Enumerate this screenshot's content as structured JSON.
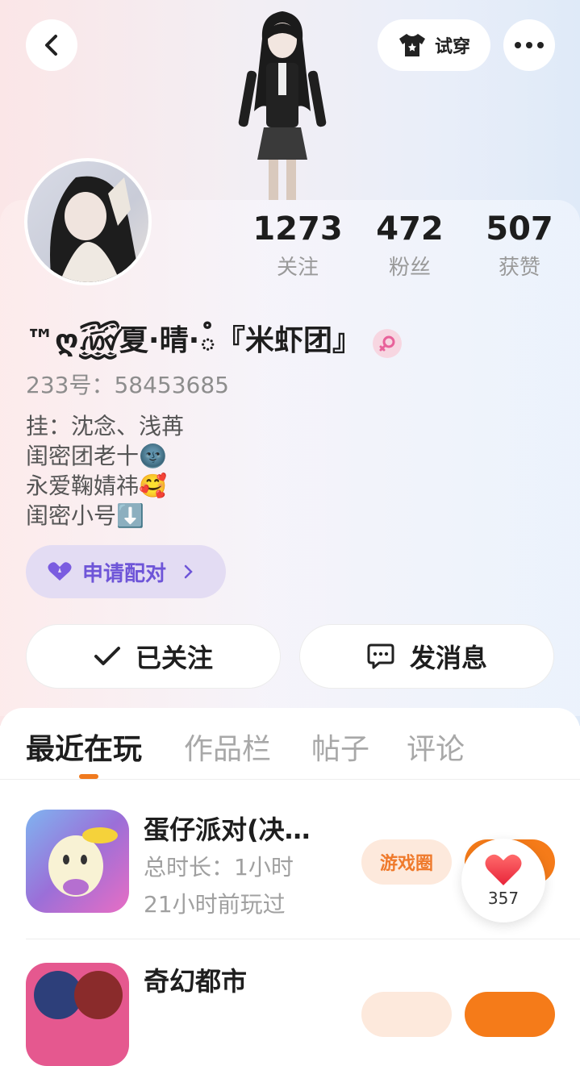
{
  "header": {
    "tryon_label": "试穿"
  },
  "stats": [
    {
      "value": "1273",
      "label": "关注"
    },
    {
      "value": "472",
      "label": "粉丝"
    },
    {
      "value": "507",
      "label": "获赞"
    }
  ],
  "profile": {
    "username": "™ღ꫞夏·晴·ఄ『米虾团』",
    "uid_line": "233号：58453685",
    "bio": [
      "挂：沈念、浅苒",
      "闺密团老十🌚",
      "永爱鞠婧祎🥰",
      "闺密小号⬇️"
    ],
    "pair_label": "申请配对"
  },
  "actions": {
    "followed_label": "已关注",
    "message_label": "发消息"
  },
  "tabs": [
    "最近在玩",
    "作品栏",
    "帖子",
    "评论"
  ],
  "games": [
    {
      "title": "蛋仔派对(决…",
      "duration": "总时长：1小时",
      "last_played": "21小时前玩过",
      "circle_label": "游戏圈"
    },
    {
      "title": "奇幻都市"
    }
  ],
  "like_count": "357",
  "colors": {
    "accent_orange": "#f57b19",
    "pair_purple": "#6e55d8"
  }
}
